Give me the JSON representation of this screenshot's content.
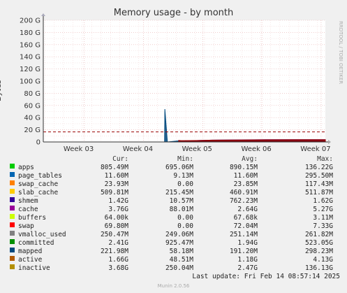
{
  "title": "Memory usage - by month",
  "side_note": "RRDTOOL / TOBI OETIKER",
  "chart_data": {
    "type": "area",
    "title": "Memory usage - by month",
    "ylabel": "Bytes",
    "xlabel": "",
    "ylim": [
      0,
      200
    ],
    "y_unit": "G",
    "yticks": [
      "0",
      "20 G",
      "40 G",
      "60 G",
      "80 G",
      "100 G",
      "120 G",
      "140 G",
      "160 G",
      "180 G",
      "200 G"
    ],
    "xticks": [
      "Week 03",
      "Week 04",
      "Week 05",
      "Week 06",
      "Week 07"
    ],
    "grid": true,
    "series": [
      {
        "name": "apps",
        "color": "#00cc00",
        "x": [
          0.48,
          0.481,
          0.52,
          0.56,
          0.6,
          0.64,
          0.68,
          0.72,
          0.76,
          0.8,
          0.84,
          0.88,
          0.92,
          0.96,
          1.0
        ],
        "y": [
          0.8,
          0.8,
          0.8,
          0.8,
          0.8,
          0.8,
          0.8,
          0.9,
          0.9,
          0.9,
          0.9,
          0.9,
          0.9,
          0.9,
          0.9
        ]
      },
      {
        "name": "page_tables",
        "color": "#0066b3",
        "x": [
          0.48,
          1.0
        ],
        "y": [
          0.01,
          0.01
        ]
      },
      {
        "name": "swap_cache",
        "color": "#ff8000",
        "x": [
          0.48,
          1.0
        ],
        "y": [
          0.02,
          0.02
        ]
      },
      {
        "name": "slab_cache",
        "color": "#ffcc00",
        "x": [
          0.48,
          1.0
        ],
        "y": [
          0.5,
          0.5
        ]
      },
      {
        "name": "cache",
        "color": "#330099",
        "x": [
          0.48,
          0.55,
          0.6,
          0.7,
          0.8,
          0.9,
          1.0
        ],
        "y": [
          0.9,
          2.5,
          3.0,
          3.5,
          3.8,
          3.8,
          3.8
        ]
      },
      {
        "name": "committed",
        "color": "#00487d",
        "x": [
          0.43,
          0.431,
          0.44,
          0.48,
          1.0
        ],
        "y": [
          0,
          54,
          0,
          1.9,
          1.9
        ]
      },
      {
        "name": "inactive",
        "color": "#990000",
        "x": [
          0.48,
          0.49,
          0.55,
          0.6,
          0.7,
          0.8,
          0.9,
          1.0
        ],
        "y": [
          2.5,
          2.2,
          2.5,
          3.0,
          3.3,
          3.6,
          3.7,
          3.7
        ]
      }
    ],
    "reference_line": {
      "value": 16.5,
      "color": "#990000",
      "style": "dashed"
    }
  },
  "legend": {
    "headers": [
      "Cur:",
      "Min:",
      "Avg:",
      "Max:"
    ],
    "rows": [
      {
        "name": "apps",
        "color": "#00cc00",
        "cur": "805.49M",
        "min": "695.06M",
        "avg": "890.15M",
        "max": "136.22G"
      },
      {
        "name": "page_tables",
        "color": "#0066b3",
        "cur": "11.60M",
        "min": "9.13M",
        "avg": "11.60M",
        "max": "295.50M"
      },
      {
        "name": "swap_cache",
        "color": "#ff8000",
        "cur": "23.93M",
        "min": "0.00",
        "avg": "23.85M",
        "max": "117.43M"
      },
      {
        "name": "slab_cache",
        "color": "#ffcc00",
        "cur": "509.81M",
        "min": "215.45M",
        "avg": "460.91M",
        "max": "511.87M"
      },
      {
        "name": "shmem",
        "color": "#330099",
        "cur": "1.42G",
        "min": "10.57M",
        "avg": "762.23M",
        "max": "1.62G"
      },
      {
        "name": "cache",
        "color": "#990099",
        "cur": "3.76G",
        "min": "88.01M",
        "avg": "2.64G",
        "max": "5.27G"
      },
      {
        "name": "buffers",
        "color": "#ccff00",
        "cur": "64.00k",
        "min": "0.00",
        "avg": "67.68k",
        "max": "3.11M"
      },
      {
        "name": "swap",
        "color": "#ff0000",
        "cur": "69.80M",
        "min": "0.00",
        "avg": "72.04M",
        "max": "7.33G"
      },
      {
        "name": "vmalloc_used",
        "color": "#808080",
        "cur": "250.47M",
        "min": "249.06M",
        "avg": "251.14M",
        "max": "261.82M"
      },
      {
        "name": "committed",
        "color": "#008f00",
        "cur": "2.41G",
        "min": "925.47M",
        "avg": "1.94G",
        "max": "523.05G"
      },
      {
        "name": "mapped",
        "color": "#00487d",
        "cur": "221.98M",
        "min": "58.18M",
        "avg": "191.20M",
        "max": "298.23M"
      },
      {
        "name": "active",
        "color": "#b35a00",
        "cur": "1.66G",
        "min": "48.51M",
        "avg": "1.18G",
        "max": "4.13G"
      },
      {
        "name": "inactive",
        "color": "#b38f00",
        "cur": "3.68G",
        "min": "250.04M",
        "avg": "2.47G",
        "max": "136.13G"
      }
    ]
  },
  "last_update": "Last update: Fri Feb 14 08:57:14 2025",
  "version": "Munin 2.0.56"
}
